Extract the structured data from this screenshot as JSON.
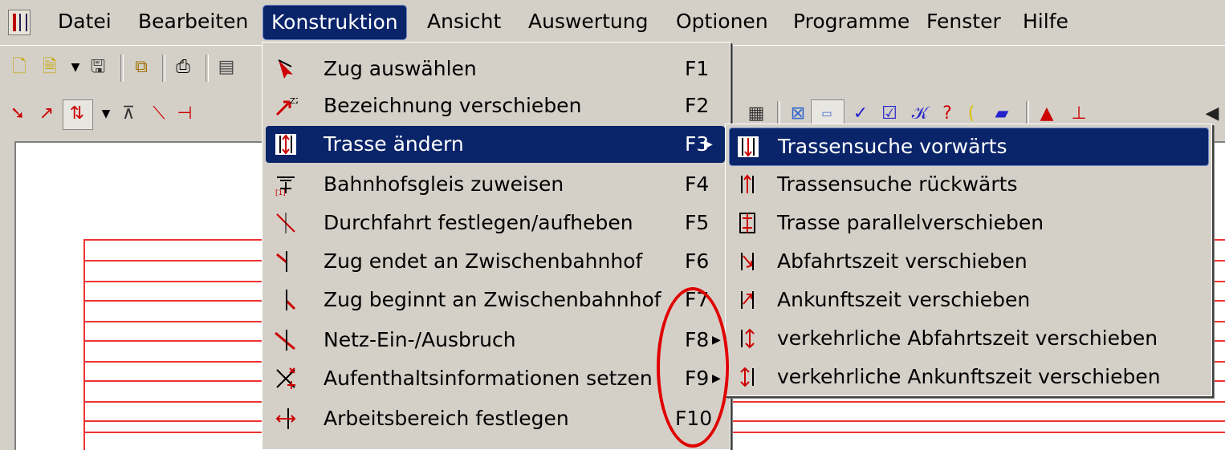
{
  "menubar": {
    "items": [
      "Datei",
      "Bearbeiten",
      "Konstruktion",
      "Ansicht",
      "Auswertung",
      "Optionen",
      "Programme",
      "Fenster",
      "Hilfe"
    ],
    "active": "Konstruktion"
  },
  "dropdown": {
    "items": [
      {
        "label": "Zug auswählen",
        "key": "F1",
        "icon": "cursor-arrow-icon"
      },
      {
        "label": "Bezeichnung verschieben",
        "key": "F2",
        "icon": "label-move-icon"
      },
      {
        "label": "Trasse ändern",
        "key": "F3",
        "icon": "trasse-change-icon",
        "submenu": true
      },
      {
        "label": "Bahnhofsgleis zuweisen",
        "key": "F4",
        "icon": "station-track-icon"
      },
      {
        "label": "Durchfahrt festlegen/aufheben",
        "key": "F5",
        "icon": "pass-through-icon"
      },
      {
        "label": "Zug endet an Zwischenbahnhof",
        "key": "F6",
        "icon": "train-ends-icon"
      },
      {
        "label": "Zug beginnt an Zwischenbahnhof",
        "key": "F7",
        "icon": "train-starts-icon"
      },
      {
        "label": "Netz-Ein-/Ausbruch",
        "key": "F8",
        "icon": "network-entry-icon",
        "submenu": true
      },
      {
        "label": "Aufenthaltsinformationen setzen",
        "key": "F9",
        "icon": "stay-info-icon",
        "submenu": true
      },
      {
        "label": "Arbeitsbereich festlegen",
        "key": "F10",
        "icon": "work-area-icon"
      }
    ]
  },
  "submenu": {
    "items": [
      {
        "label": "Trassensuche vorwärts",
        "icon": "search-forward-icon"
      },
      {
        "label": "Trassensuche rückwärts",
        "icon": "search-backward-icon"
      },
      {
        "label": "Trasse parallelverschieben",
        "icon": "parallel-shift-icon"
      },
      {
        "label": "Abfahrtszeit verschieben",
        "icon": "departure-shift-icon"
      },
      {
        "label": "Ankunftszeit verschieben",
        "icon": "arrival-shift-icon"
      },
      {
        "label": "verkehrliche Abfahrtszeit verschieben",
        "icon": "traffic-departure-icon"
      },
      {
        "label": "verkehrliche Ankunftszeit verschieben",
        "icon": "traffic-arrival-icon"
      }
    ]
  },
  "colors": {
    "menu_bg": "#d4d0c8",
    "highlight": "#0a246a",
    "graph_line": "#e33333",
    "annotation": "#e00000"
  }
}
